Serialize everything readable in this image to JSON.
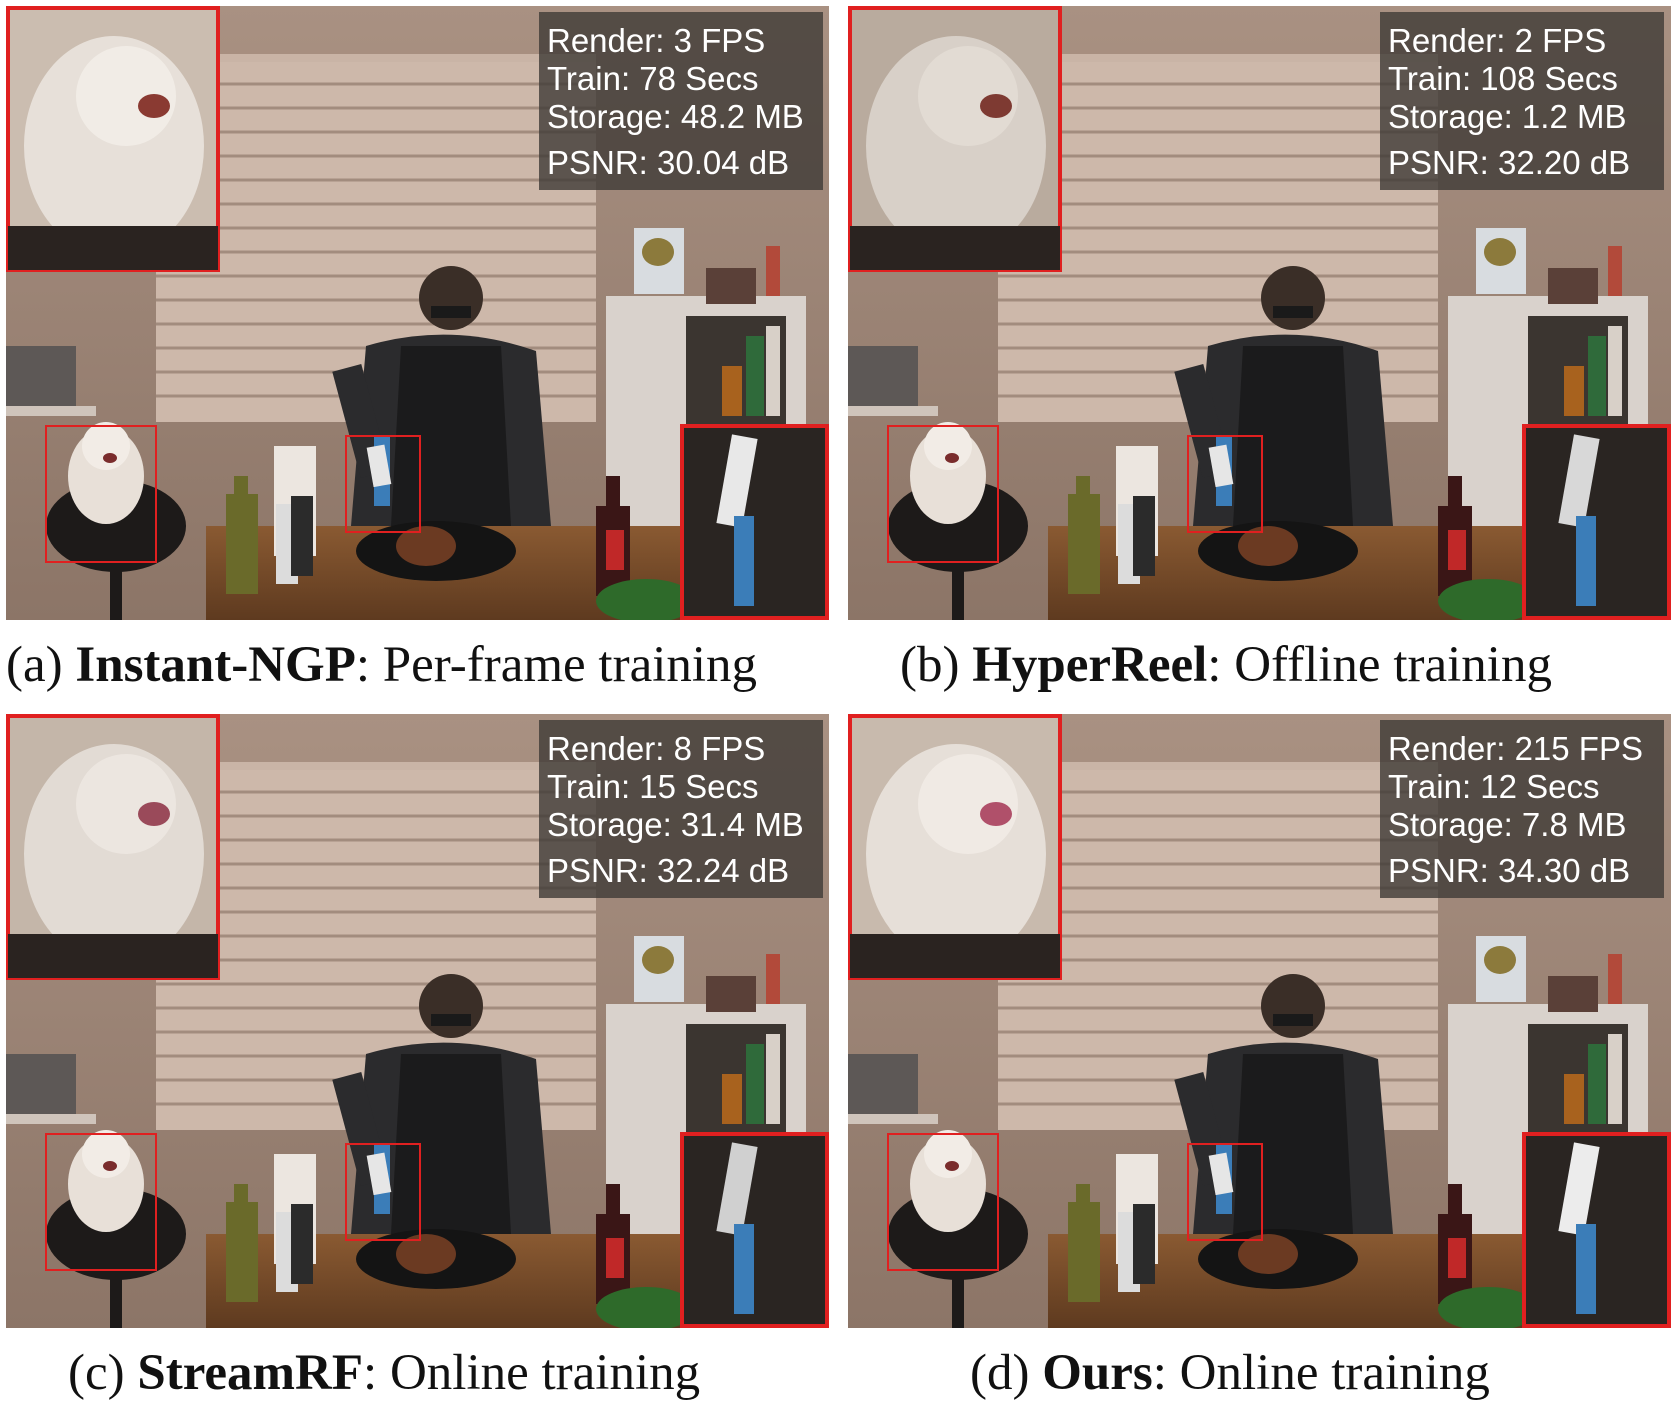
{
  "panels": [
    {
      "id": "a",
      "caption": {
        "prefix": "(a) ",
        "method": "Instant-NGP",
        "suffix": ": Per-frame training"
      },
      "stats": {
        "render": "Render: 3 FPS",
        "train": "Train: 78 Secs",
        "storage": "Storage: 48.2 MB",
        "psnr": "PSNR: 30.04 dB"
      }
    },
    {
      "id": "b",
      "caption": {
        "prefix": "(b) ",
        "method": "HyperReel",
        "suffix": ": Offline training"
      },
      "stats": {
        "render": "Render: 2 FPS",
        "train": "Train: 108 Secs",
        "storage": "Storage: 1.2 MB",
        "psnr": "PSNR: 32.20 dB"
      }
    },
    {
      "id": "c",
      "caption": {
        "prefix": "(c) ",
        "method": "StreamRF",
        "suffix": ": Online training"
      },
      "stats": {
        "render": "Render: 8 FPS",
        "train": "Train: 15 Secs",
        "storage": "Storage: 31.4 MB",
        "psnr": "PSNR: 32.24 dB"
      }
    },
    {
      "id": "d",
      "caption": {
        "prefix": "(d) ",
        "method": "Ours",
        "suffix": ": Online training"
      },
      "stats": {
        "render": "Render: 215 FPS",
        "train": "Train: 12 Secs",
        "storage": "Storage: 7.8 MB",
        "psnr": "PSNR: 34.30 dB"
      }
    }
  ],
  "colors": {
    "highlight_box": "#e02020",
    "stats_bg": "#3c3834",
    "wall": "#b9a294",
    "blinds": "#d9c8bc"
  }
}
